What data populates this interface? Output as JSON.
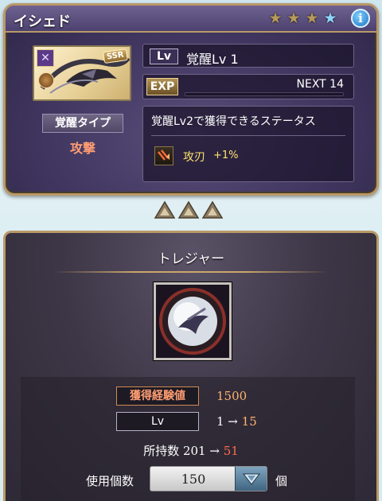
{
  "header": {
    "title": "イシェド",
    "stars": {
      "filled": 3,
      "blue": 1
    },
    "info_label": "i"
  },
  "summon": {
    "rarity": "SSR",
    "element_icon": "dark-element-icon",
    "type_icon": "attack-type-icon",
    "type_label": "覚醒タイプ",
    "type_value": "攻撃"
  },
  "level": {
    "tag": "Lv",
    "value": "覚醒Lv 1"
  },
  "exp": {
    "tag": "EXP",
    "next": "NEXT 14",
    "fill_fraction": 0.0
  },
  "status": {
    "title": "覚醒Lv2で獲得できるステータス",
    "stat_icon": "attack-up-icon",
    "stat_name": "攻刃",
    "stat_bonus": "+1%"
  },
  "treasure": {
    "title": "トレジャー",
    "gain_label": "獲得経験値",
    "gain_value": "1500",
    "lv_label": "Lv",
    "lv_from": "1 →",
    "lv_to": "15",
    "owned_prefix": "所持数 201 →",
    "owned_after": "51",
    "use_label": "使用個数",
    "use_value": "150",
    "unit": "個"
  },
  "colors": {
    "accent_gold": "#b99968",
    "panel_purple": "#3e345d",
    "highlight_orange": "#ffb26f",
    "after_red": "#ff6b4a",
    "stat_yellow": "#ffe36e"
  }
}
